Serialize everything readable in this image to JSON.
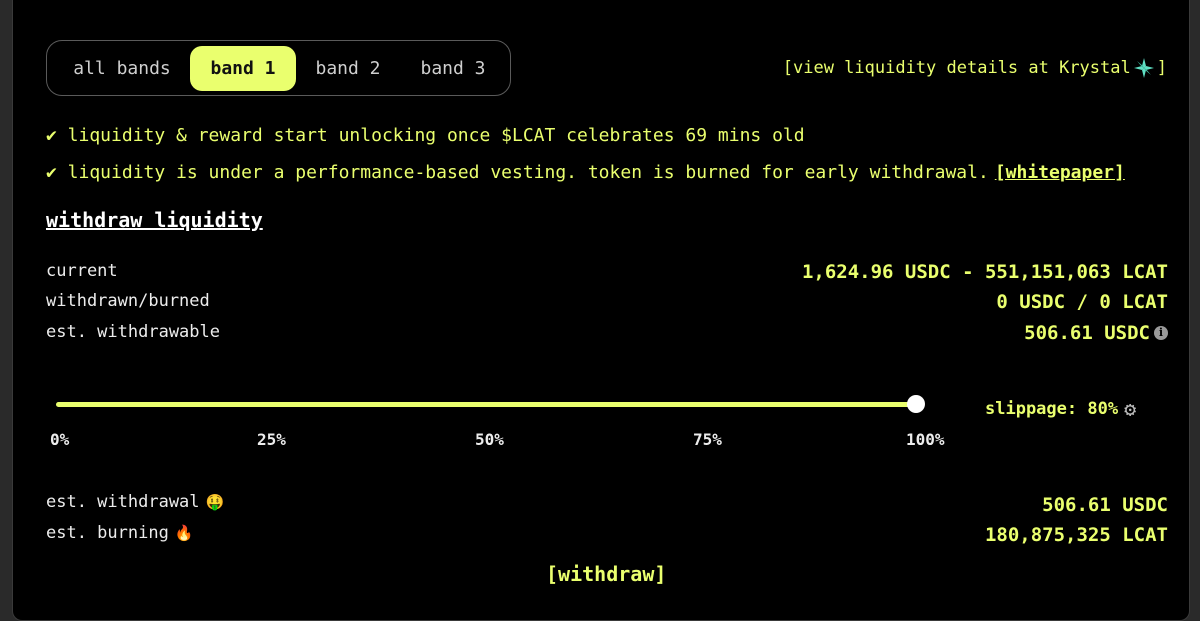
{
  "tabs": [
    {
      "label": "all bands",
      "active": false
    },
    {
      "label": "band 1",
      "active": true
    },
    {
      "label": "band 2",
      "active": false
    },
    {
      "label": "band 3",
      "active": false
    }
  ],
  "krystal_link": {
    "prefix": "[view liquidity details at Krystal",
    "suffix": "]"
  },
  "notes": [
    "✔ liquidity & reward start unlocking once $LCAT celebrates 69 mins old",
    "✔ liquidity is under a performance-based vesting. token is burned for early withdrawal."
  ],
  "whitepaper_link": "[whitepaper]",
  "section_title": "withdraw liquidity",
  "stats": [
    {
      "label": "current",
      "value": "1,624.96 USDC - 551,151,063 LCAT"
    },
    {
      "label": "withdrawn/burned",
      "value": "0 USDC / 0 LCAT"
    },
    {
      "label": "est. withdrawable",
      "value": "506.61 USDC"
    }
  ],
  "slider": {
    "percent": 100,
    "ticks": [
      "0%",
      "25%",
      "50%",
      "75%",
      "100%"
    ]
  },
  "slippage": "slippage: 80%",
  "results": [
    {
      "label": "est. withdrawal",
      "emoji": "🤑",
      "value": "506.61 USDC"
    },
    {
      "label": "est. burning",
      "emoji": "🔥",
      "value": "180,875,325 LCAT"
    }
  ],
  "withdraw_button": "[withdraw]",
  "colors": {
    "accent": "#eaff6e",
    "background": "#000000",
    "text": "#ececec"
  }
}
